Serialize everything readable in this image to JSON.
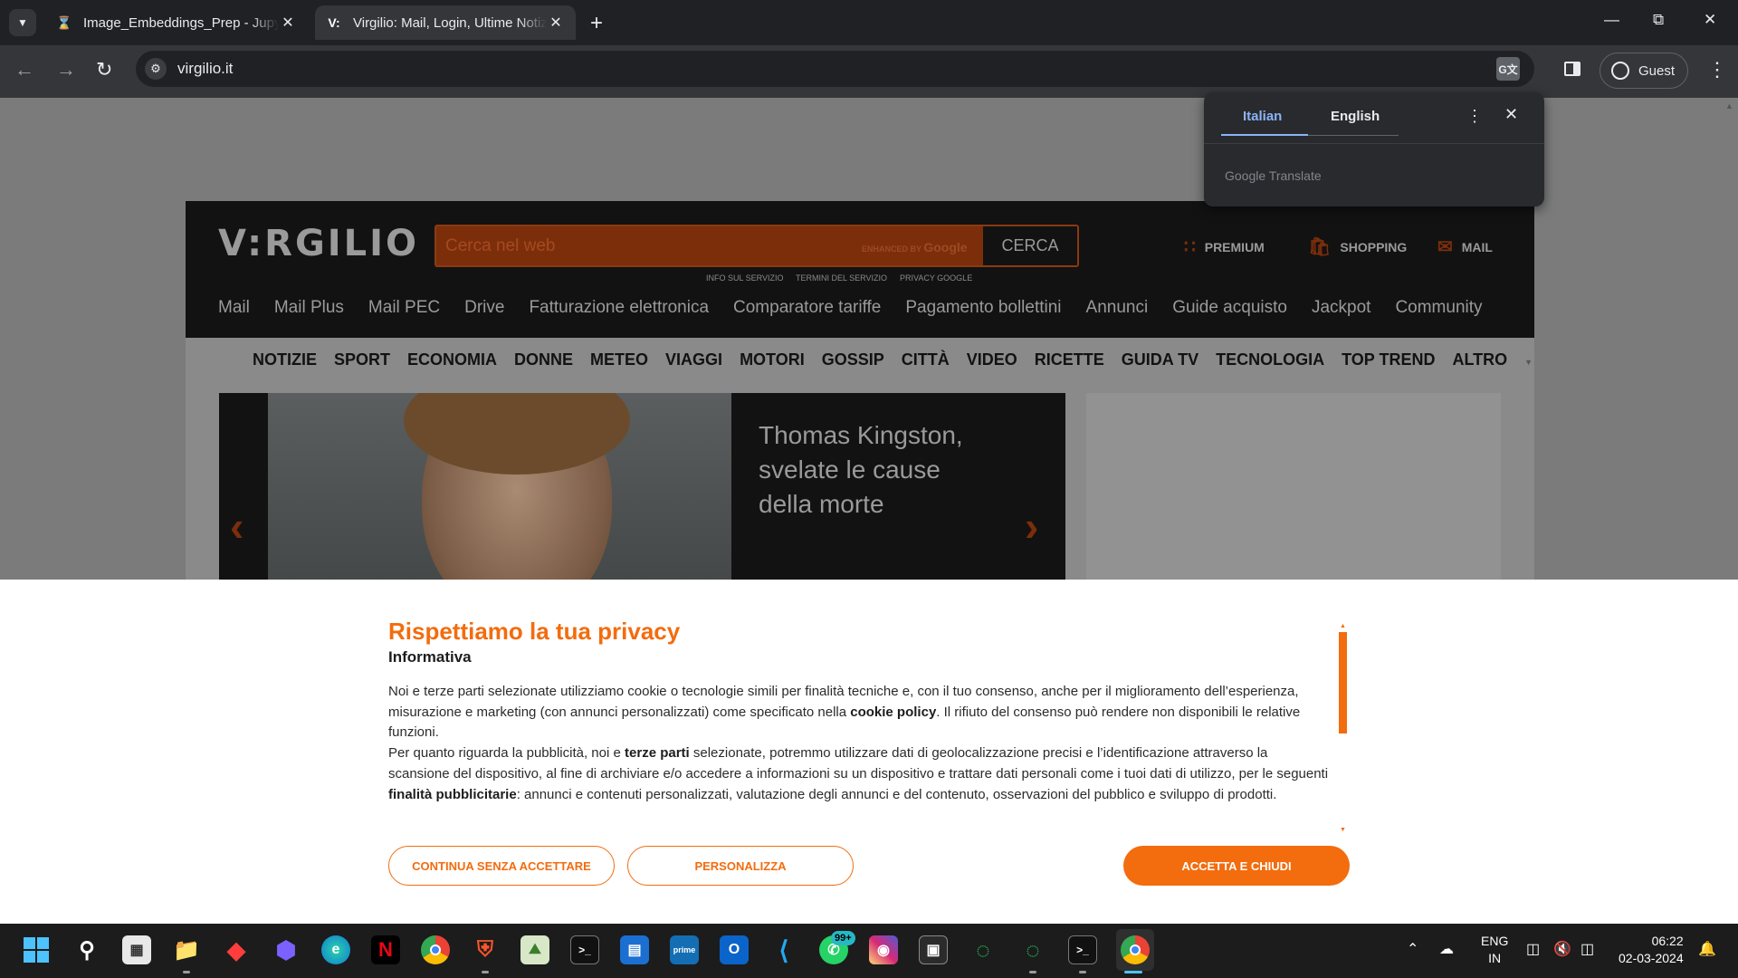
{
  "browser": {
    "tabs": [
      {
        "title": "Image_Embeddings_Prep - Jupyter",
        "favicon": "hourglass-icon",
        "active": false
      },
      {
        "title": "Virgilio: Mail, Login, Ultime Notizie",
        "favicon_text": "V:",
        "active": true
      }
    ],
    "url": "virgilio.it",
    "profile_label": "Guest"
  },
  "translate_popup": {
    "source_lang": "Italian",
    "target_lang": "English",
    "brand": "Google Translate"
  },
  "site": {
    "logo": "V:RGILIO",
    "search": {
      "placeholder": "Cerca nel web",
      "enhanced_prefix": "ENHANCED BY",
      "enhanced_brand": "Google",
      "button": "CERCA"
    },
    "legal_links": [
      "INFO SUL SERVIZIO",
      "TERMINI DEL SERVIZIO",
      "PRIVACY GOOGLE"
    ],
    "header_links": [
      {
        "label": "PREMIUM",
        "icon": "grid-icon"
      },
      {
        "label": "SHOPPING",
        "icon": "shopping-bag-icon"
      },
      {
        "label": "MAIL",
        "icon": "mail-icon"
      }
    ],
    "services": [
      "Mail",
      "Mail Plus",
      "Mail PEC",
      "Drive",
      "Fatturazione elettronica",
      "Comparatore tariffe",
      "Pagamento bollettini",
      "Annunci",
      "Guide acquisto",
      "Jackpot",
      "Community"
    ],
    "categories": [
      "NOTIZIE",
      "SPORT",
      "ECONOMIA",
      "DONNE",
      "METEO",
      "VIAGGI",
      "MOTORI",
      "GOSSIP",
      "CITTÀ",
      "VIDEO",
      "RICETTE",
      "GUIDA TV",
      "TECNOLOGIA",
      "TOP TREND",
      "ALTRO"
    ],
    "hero_title": "Thomas Kingston, svelate le cause della morte"
  },
  "cookie": {
    "title": "Rispettiamo la tua privacy",
    "subtitle": "Informativa",
    "p1_a": "Noi e terze parti selezionate utilizziamo cookie o tecnologie simili per finalità tecniche e, con il tuo consenso, anche per il miglioramento dell’esperienza, misurazione e marketing (con annunci personalizzati) come specificato nella ",
    "p1_bold": "cookie policy",
    "p1_b": ". Il rifiuto del consenso può rendere non disponibili le relative funzioni.",
    "p2_a": "Per quanto riguarda la pubblicità, noi e ",
    "p2_bold1": "terze parti",
    "p2_b": " selezionate, potremmo utilizzare dati di geolocalizzazione precisi e l’identificazione attraverso la scansione del dispositivo, al fine di archiviare e/o accedere a informazioni su un dispositivo e trattare dati personali come i tuoi dati di utilizzo, per le seguenti ",
    "p2_bold2": "finalità pubblicitarie",
    "p2_c": ": annunci e contenuti personalizzati, valutazione degli annunci e del contenuto, osservazioni del pubblico e sviluppo di prodotti.",
    "btn_reject": "CONTINUA SENZA ACCETTARE",
    "btn_customize": "PERSONALIZZA",
    "btn_accept": "ACCETTA E CHIUDI",
    "accent": "#f36c0e"
  },
  "taskbar": {
    "whatsapp_badge": "99+",
    "lang_line1": "ENG",
    "lang_line2": "IN",
    "time": "06:22",
    "date": "02-03-2024"
  }
}
